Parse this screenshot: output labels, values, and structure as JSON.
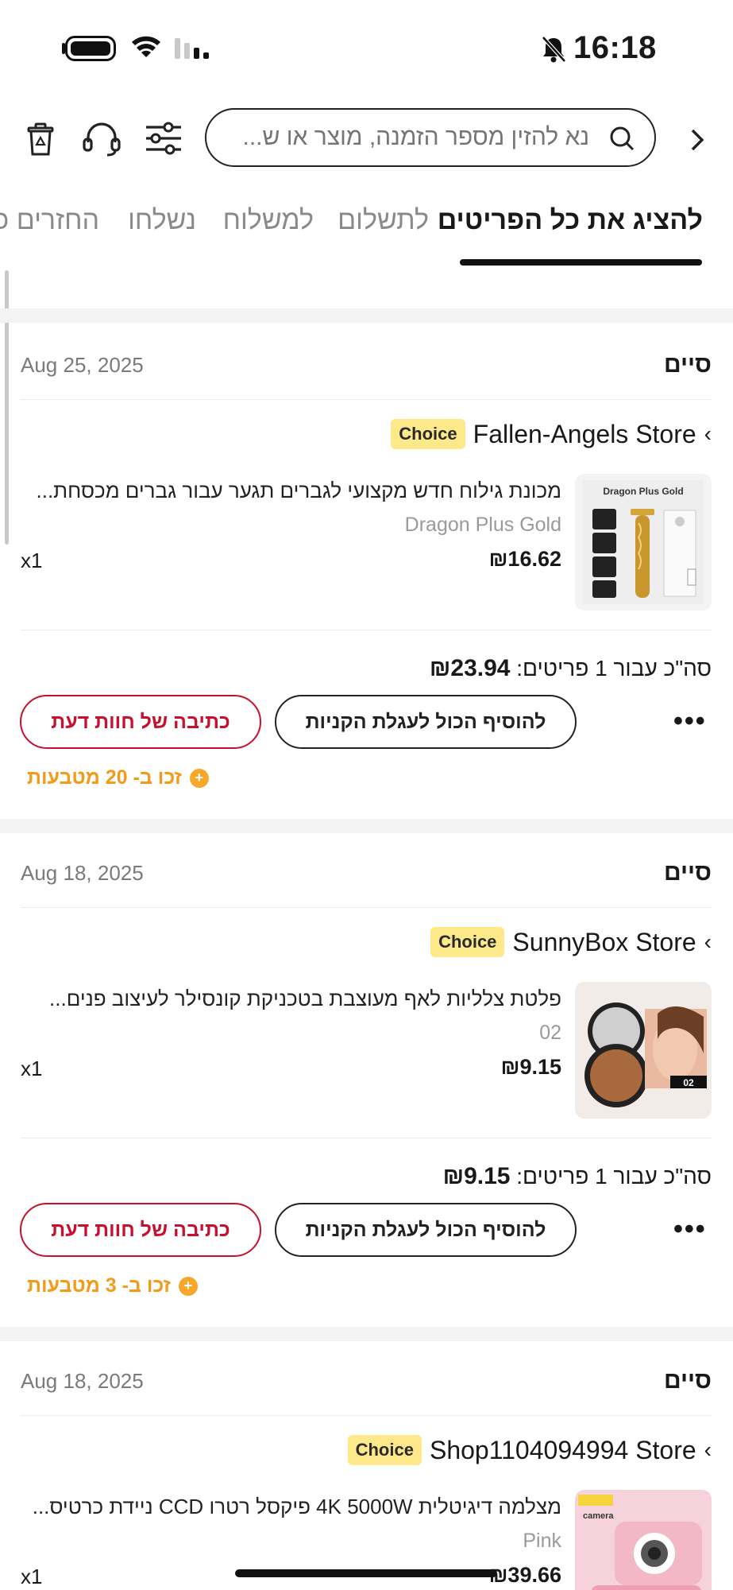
{
  "status_bar": {
    "time": "16:18"
  },
  "search": {
    "placeholder": "נא להזין מספר הזמנה, מוצר או ש..."
  },
  "tabs": [
    "להציג את כל הפריטים",
    "לתשלום",
    "למשלוח",
    "נשלחו",
    "החזרים כ"
  ],
  "orders": [
    {
      "status": "סיים",
      "date": "Aug 25, 2025",
      "badge": "Choice",
      "store": "Fallen-Angels Store",
      "product_name": "מכונת גילוח חדש מקצועי לגברים תגער עבור גברים מכסחת...",
      "variant": "Dragon Plus Gold",
      "price": "₪16.62",
      "qty": "x1",
      "total_label": "סה\"כ עבור 1 פריטים:",
      "total_value": "₪23.94",
      "add_to_cart": "להוסיף הכול לעגלת הקניות",
      "write_review": "כתיבה של חוות דעת",
      "coins": "זכו ב- 20 מטבעות"
    },
    {
      "status": "סיים",
      "date": "Aug 18, 2025",
      "badge": "Choice",
      "store": "SunnyBox Store",
      "product_name": "פלטת צלליות לאף מעוצבת בטכניקת קונסילר לעיצוב פנים...",
      "variant": "02",
      "price": "₪9.15",
      "qty": "x1",
      "total_label": "סה\"כ עבור 1 פריטים:",
      "total_value": "₪9.15",
      "add_to_cart": "להוסיף הכול לעגלת הקניות",
      "write_review": "כתיבה של חוות דעת",
      "coins": "זכו ב- 3 מטבעות"
    },
    {
      "status": "סיים",
      "date": "Aug 18, 2025",
      "badge": "Choice",
      "store": "Shop1104094994 Store",
      "product_name": "מצלמה דיגיטלית 4K 5000W פיקסל רטרו CCD ניידת כרטיס...",
      "variant": "Pink",
      "price": "₪39.66",
      "qty": "x1"
    }
  ],
  "thumb_labels": {
    "trimmer_brand": "Dragon Plus Gold",
    "compact_tag": "02",
    "camera_tag": "camera"
  },
  "colors": {
    "accent_red": "#c8102e",
    "coin_orange": "#f39a1a",
    "choice_yellow": "#fde98a"
  }
}
